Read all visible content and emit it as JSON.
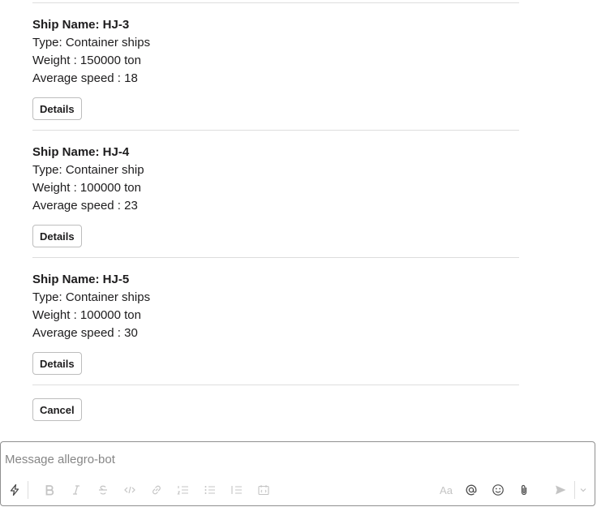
{
  "ships": [
    {
      "name": "Ship Name: HJ-3",
      "type": "Type: Container ships",
      "weight": "Weight : 150000 ton",
      "speed": "Average speed : 18",
      "button": "Details"
    },
    {
      "name": "Ship Name: HJ-4",
      "type": "Type: Container ship",
      "weight": "Weight : 100000 ton",
      "speed": "Average speed : 23",
      "button": "Details"
    },
    {
      "name": "Ship Name: HJ-5",
      "type": "Type: Container ships",
      "weight": "Weight : 100000 ton",
      "speed": "Average speed : 30",
      "button": "Details"
    }
  ],
  "cancel_label": "Cancel",
  "composer": {
    "placeholder": "Message allegro-bot",
    "toolbar_icons": [
      "lightning-icon",
      "bold-icon",
      "italic-icon",
      "strikethrough-icon",
      "code-icon",
      "link-icon",
      "ordered-list-icon",
      "bulleted-list-icon",
      "blockquote-icon",
      "code-block-icon",
      "text-format-icon",
      "mention-icon",
      "emoji-icon",
      "attachment-icon",
      "send-icon",
      "send-options-icon"
    ],
    "format_label": "Aa"
  }
}
